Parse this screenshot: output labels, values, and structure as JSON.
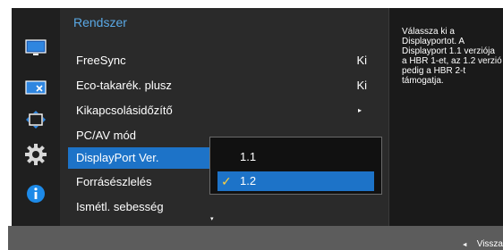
{
  "menu": {
    "title": "Rendszer",
    "items": [
      {
        "label": "FreeSync",
        "value": "Ki"
      },
      {
        "label": "Eco-takarék. plusz",
        "value": "Ki"
      },
      {
        "label": "Kikapcsolásidőzítő",
        "arrow": "▸"
      },
      {
        "label": "PC/AV mód"
      },
      {
        "label": "DisplayPort Ver.",
        "selected": true
      },
      {
        "label": "Forrásészlelés"
      },
      {
        "label": "Ismétl. sebesség"
      }
    ],
    "scroll_indicator": "▾"
  },
  "icons": [
    {
      "name": "picture-icon"
    },
    {
      "name": "screen-adjust-icon"
    },
    {
      "name": "position-arrows-icon"
    },
    {
      "name": "settings-gear-icon",
      "active": true
    },
    {
      "name": "info-icon"
    }
  ],
  "dropdown": {
    "options": [
      {
        "label": "1.1"
      },
      {
        "label": "1.2",
        "selected": true,
        "check": "✓"
      }
    ]
  },
  "help": {
    "text": "Válassza ki a Displayportot. A Displayport 1.1 verziója a HBR 1-et, az 1.2 verzió pedig a HBR 2-t támogatja."
  },
  "footer": {
    "back_icon": "◄",
    "back_label": "Vissza"
  },
  "colors": {
    "accent": "#1d73c8",
    "title": "#5aa9e6",
    "check": "#ffd23f"
  }
}
